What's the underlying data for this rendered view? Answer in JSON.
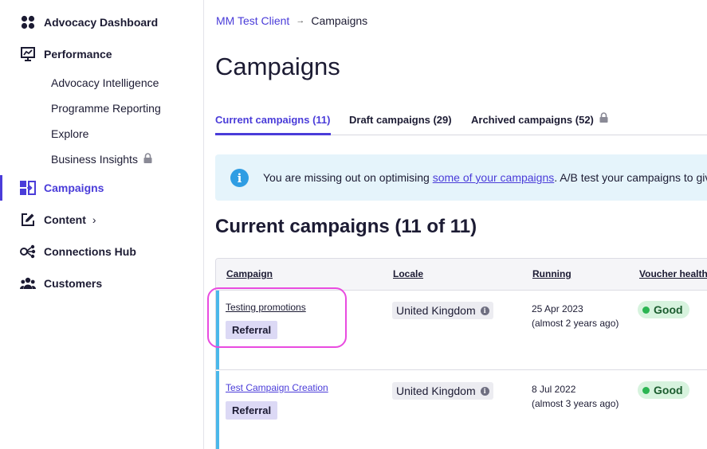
{
  "sidebar": {
    "items": [
      {
        "label": "Advocacy Dashboard"
      },
      {
        "label": "Performance",
        "subitems": [
          {
            "label": "Advocacy Intelligence"
          },
          {
            "label": "Programme Reporting"
          },
          {
            "label": "Explore"
          },
          {
            "label": "Business Insights",
            "locked": true
          }
        ]
      },
      {
        "label": "Campaigns",
        "active": true
      },
      {
        "label": "Content",
        "chevron": "›"
      },
      {
        "label": "Connections Hub"
      },
      {
        "label": "Customers"
      }
    ]
  },
  "breadcrumb": {
    "parent": "MM Test Client",
    "separator": "→",
    "current": "Campaigns"
  },
  "page": {
    "title": "Campaigns"
  },
  "tabs": [
    {
      "label": "Current campaigns (11)",
      "active": true
    },
    {
      "label": "Draft campaigns (29)"
    },
    {
      "label": "Archived campaigns (52)",
      "locked": true
    }
  ],
  "banner": {
    "icon": "i",
    "text_before": "You are missing out on optimising ",
    "link": "some of your campaigns",
    "text_after": ". A/B test your campaigns to give"
  },
  "section": {
    "title": "Current campaigns (11 of 11)"
  },
  "table": {
    "columns": [
      "Campaign",
      "Locale",
      "Running",
      "Voucher health"
    ],
    "rows": [
      {
        "campaign": "Testing promotions",
        "type": "Referral",
        "locale": "United Kingdom",
        "running_date": "25 Apr 2023",
        "running_ago": "(almost 2 years ago)",
        "health": "Good"
      },
      {
        "campaign": "Test Campaign Creation",
        "type": "Referral",
        "locale": "United Kingdom",
        "running_date": "8 Jul 2022",
        "running_ago": "(almost 3 years ago)",
        "health": "Good"
      }
    ]
  },
  "colors": {
    "accent": "#4a3cd9",
    "row_marker": "#4bb8ea",
    "highlight": "#e94be0",
    "good": "#2bb552"
  }
}
